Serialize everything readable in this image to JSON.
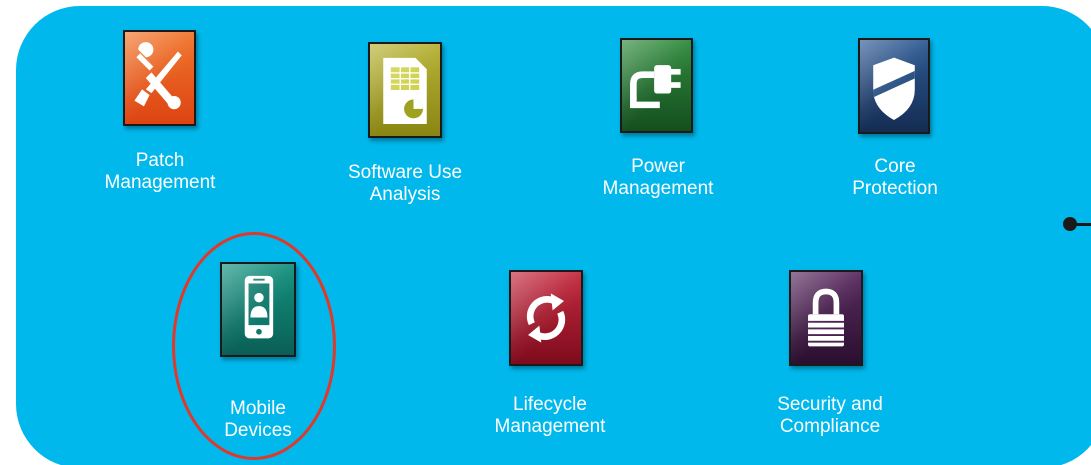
{
  "modules": [
    {
      "id": "patch",
      "label": "Patch\nManagement",
      "icon": "wrench-screwdriver-icon",
      "color": "#e8531c"
    },
    {
      "id": "software",
      "label": "Software Use\nAnalysis",
      "icon": "spreadsheet-pie-icon",
      "color": "#9e9a1c"
    },
    {
      "id": "power",
      "label": "Power\nManagement",
      "icon": "power-plug-icon",
      "color": "#1f6b2c"
    },
    {
      "id": "core",
      "label": "Core\nProtection",
      "icon": "shield-icon",
      "color": "#1e3f6e"
    },
    {
      "id": "mobile",
      "label": "Mobile\nDevices",
      "icon": "mobile-phone-icon",
      "color": "#0e7a6c"
    },
    {
      "id": "lifecycle",
      "label": "Lifecycle\nManagement",
      "icon": "refresh-arrows-icon",
      "color": "#a3142a"
    },
    {
      "id": "security",
      "label": "Security and\nCompliance",
      "icon": "padlock-icon",
      "color": "#3f1a45"
    }
  ],
  "highlight": {
    "target": "mobile",
    "color": "#e0382b"
  },
  "panel_color": "#00b8ec"
}
